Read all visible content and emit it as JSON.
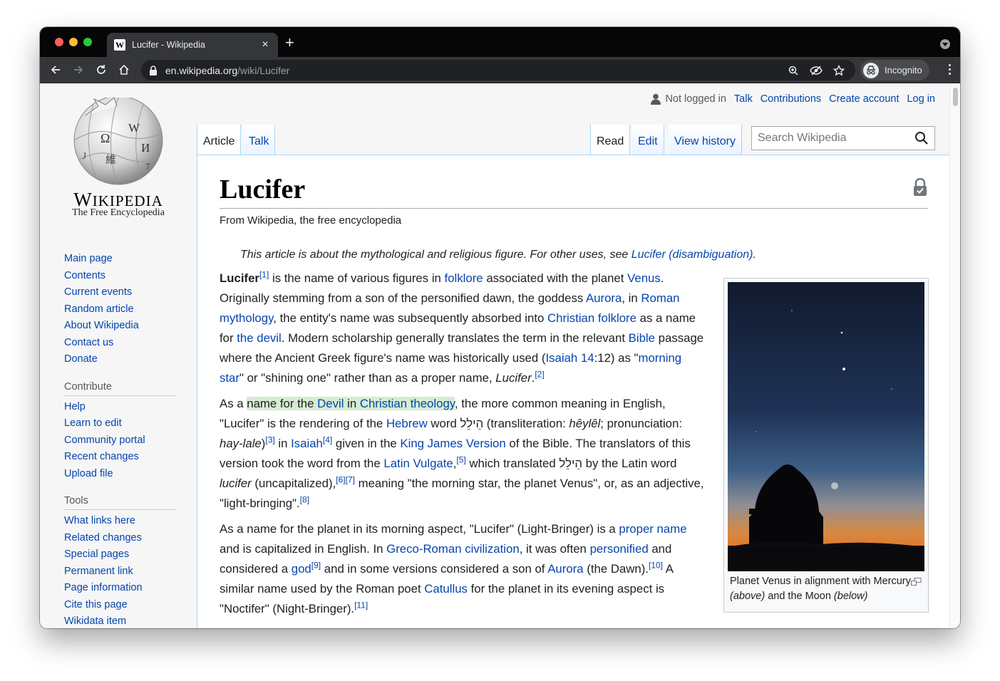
{
  "browser": {
    "tab_title": "Lucifer - Wikipedia",
    "url_host": "en.wikipedia.org",
    "url_path": "/wiki/Lucifer",
    "profile_label": "Incognito",
    "new_tab": "+",
    "close_tab": "×"
  },
  "wiki": {
    "wordmark_big": "W",
    "wordmark_rest": "IKIPEDIA",
    "tagline": "The Free Encyclopedia",
    "personal": {
      "not_logged_in": "Not logged in",
      "talk": "Talk",
      "contributions": "Contributions",
      "create_account": "Create account",
      "log_in": "Log in"
    },
    "tabs": {
      "article": "Article",
      "talk": "Talk",
      "read": "Read",
      "edit": "Edit",
      "history": "View history"
    },
    "search_placeholder": "Search Wikipedia",
    "navigation": [
      "Main page",
      "Contents",
      "Current events",
      "Random article",
      "About Wikipedia",
      "Contact us",
      "Donate"
    ],
    "contribute_heading": "Contribute",
    "contribute": [
      "Help",
      "Learn to edit",
      "Community portal",
      "Recent changes",
      "Upload file"
    ],
    "tools_heading": "Tools",
    "tools": [
      "What links here",
      "Related changes",
      "Special pages",
      "Permanent link",
      "Page information",
      "Cite this page",
      "Wikidata item"
    ]
  },
  "article": {
    "title": "Lucifer",
    "site_sub": "From Wikipedia, the free encyclopedia",
    "hatnote_text": "This article is about the mythological and religious figure. For other uses, see ",
    "hatnote_link": "Lucifer (disambiguation)",
    "hatnote_end": ".",
    "caption_a": "Planet Venus in alignment with Mercury ",
    "caption_above": "(above)",
    "caption_b": " and the Moon ",
    "caption_below": "(below)"
  },
  "colors": {
    "link": "#0645ad",
    "highlight": "#d5ecd1",
    "tab_border": "#a7d7f9"
  }
}
